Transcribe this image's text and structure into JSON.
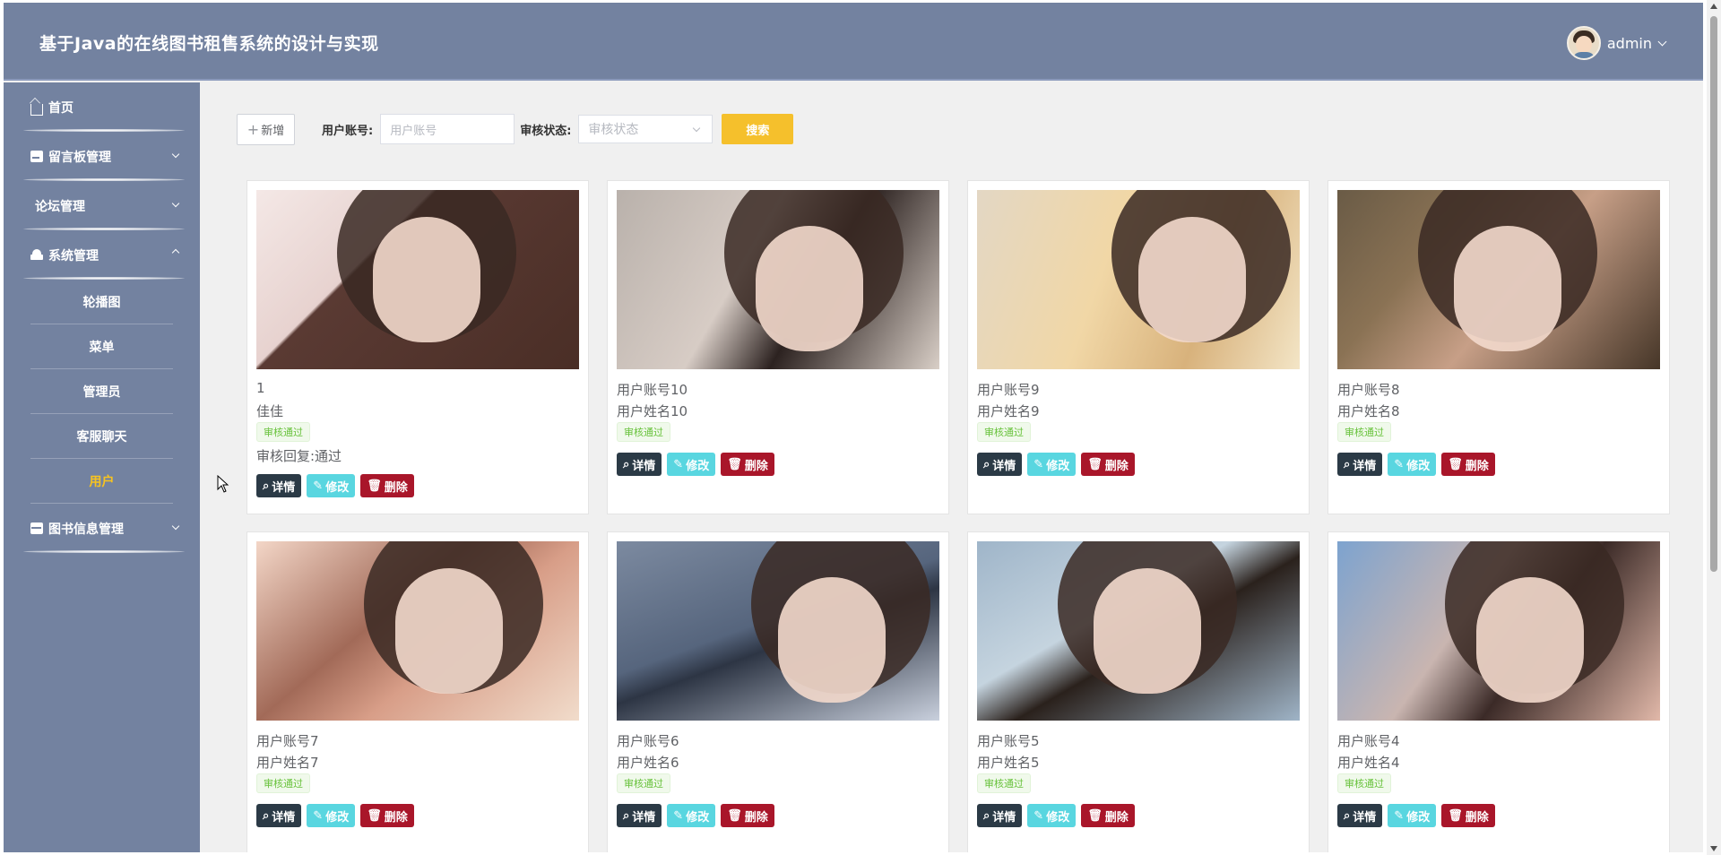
{
  "header": {
    "title": "基于Java的在线图书租售系统的设计与实现",
    "user": "admin"
  },
  "sidebar": {
    "items": [
      {
        "label": "首页",
        "icon": "home-icon"
      },
      {
        "label": "留言板管理",
        "icon": "board-icon"
      },
      {
        "label": "论坛管理",
        "icon": ""
      },
      {
        "label": "系统管理",
        "icon": "system-icon"
      },
      {
        "label": "图书信息管理",
        "icon": "book-icon"
      }
    ],
    "sub_items": [
      "轮播图",
      "菜单",
      "管理员",
      "客服聊天",
      "用户"
    ]
  },
  "toolbar": {
    "add_label": "新增",
    "account_label": "用户账号:",
    "account_placeholder": "用户账号",
    "status_label": "审核状态:",
    "status_placeholder": "审核状态",
    "search_label": "搜索"
  },
  "actions": {
    "detail": "详情",
    "edit": "修改",
    "delete": "删除"
  },
  "cards": [
    {
      "line1": "1",
      "line2": "佳佳",
      "tag": "审核通过",
      "reply": "审核回复:通过"
    },
    {
      "line1": "用户账号10",
      "line2": "用户姓名10",
      "tag": "审核通过"
    },
    {
      "line1": "用户账号9",
      "line2": "用户姓名9",
      "tag": "审核通过"
    },
    {
      "line1": "用户账号8",
      "line2": "用户姓名8",
      "tag": "审核通过"
    },
    {
      "line1": "用户账号7",
      "line2": "用户姓名7",
      "tag": "审核通过"
    },
    {
      "line1": "用户账号6",
      "line2": "用户姓名6",
      "tag": "审核通过"
    },
    {
      "line1": "用户账号5",
      "line2": "用户姓名5",
      "tag": "审核通过"
    },
    {
      "line1": "用户账号4",
      "line2": "用户姓名4",
      "tag": "审核通过"
    }
  ],
  "colors": {
    "header_bg": "#7382a0",
    "accent": "#f5c02c",
    "detail_btn": "#2b3a46",
    "edit_btn": "#59d6e0",
    "delete_btn": "#a9162a",
    "tag_green": "#67c23a"
  }
}
